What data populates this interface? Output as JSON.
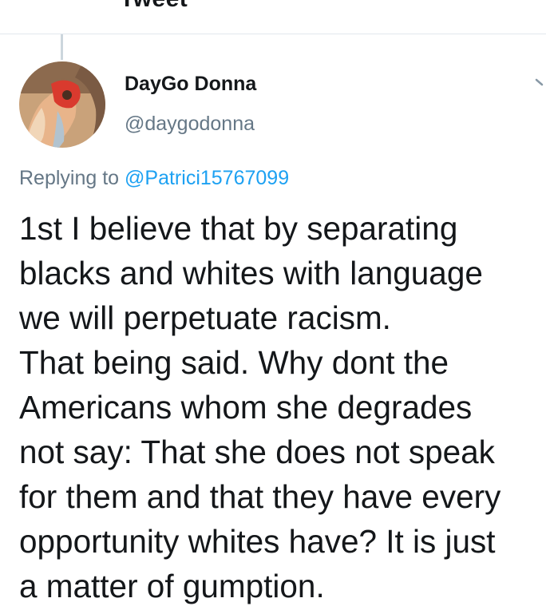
{
  "header": {
    "title": "Tweet"
  },
  "tweet": {
    "author": {
      "display_name": "DayGo Donna",
      "handle": "@daygodonna"
    },
    "replying_to_prefix": "Replying to ",
    "replying_to_handle": "@Patrici15767099",
    "text_lines": [
      "1st I believe that by separating",
      "blacks and whites with language",
      "we will perpetuate racism.",
      "That being said. Why dont the",
      "Americans whom she degrades",
      "not say: That she does not speak",
      "for them and that they have every",
      "opportunity whites have? It is just",
      "a matter of gumption."
    ]
  },
  "colors": {
    "accent": "#1da1f2",
    "secondary_text": "#657786",
    "primary_text": "#14171a",
    "divider": "#e1e8ed"
  },
  "icons": {
    "back": "back-arrow-icon",
    "more": "chevron-down-icon"
  }
}
